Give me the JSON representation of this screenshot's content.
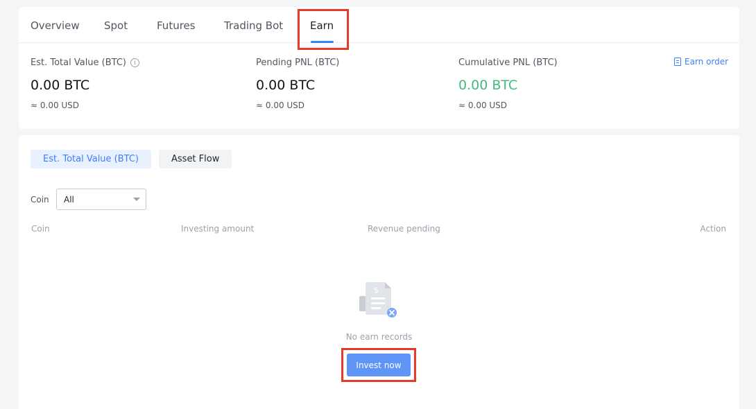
{
  "tabs": [
    {
      "label": "Overview"
    },
    {
      "label": "Spot"
    },
    {
      "label": "Futures"
    },
    {
      "label": "Trading Bot"
    },
    {
      "label": "Earn",
      "active": true
    }
  ],
  "stats": {
    "total": {
      "label": "Est. Total Value (BTC)",
      "value": "0.00 BTC",
      "usd": "≈ 0.00 USD",
      "info_icon": "info-icon"
    },
    "pending": {
      "label": "Pending PNL (BTC)",
      "value": "0.00 BTC",
      "usd": "≈ 0.00 USD"
    },
    "cumulative": {
      "label": "Cumulative PNL (BTC)",
      "value": "0.00 BTC",
      "usd": "≈ 0.00 USD",
      "value_color": "#45b97c"
    }
  },
  "earn_order": {
    "label": "Earn order",
    "icon": "document-icon"
  },
  "subtabs": {
    "active": "Est. Total Value (BTC)",
    "other": "Asset Flow"
  },
  "filter": {
    "label": "Coin",
    "selected": "All"
  },
  "table": {
    "columns": [
      "Coin",
      "Investing amount",
      "Revenue pending",
      "Action"
    ]
  },
  "empty": {
    "text": "No earn records",
    "icon": "empty-records-icon",
    "button": "Invest now"
  },
  "colors": {
    "accent": "#3d7eff",
    "positive": "#45b97c",
    "highlight": "#e53a25"
  }
}
